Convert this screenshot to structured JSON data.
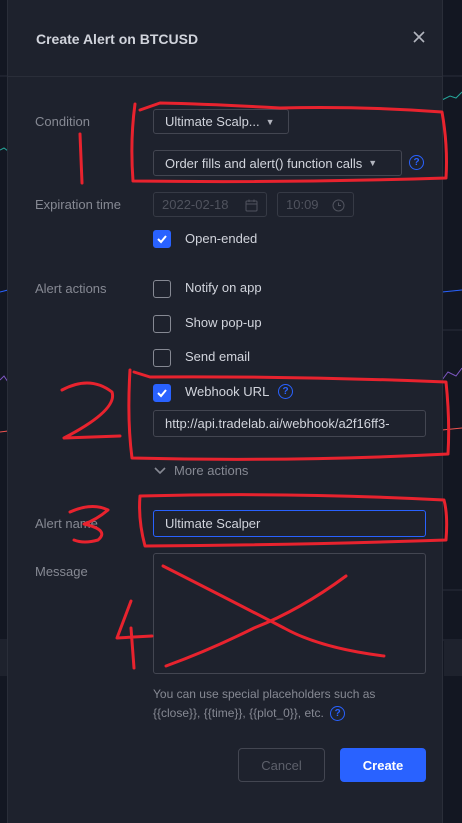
{
  "colors": {
    "accent": "#2962ff",
    "annotation": "#e8232e",
    "dialog_bg": "#1e222d",
    "page_bg": "#131722"
  },
  "dialog": {
    "title": "Create Alert on BTCUSD",
    "close_icon": "close-icon"
  },
  "condition": {
    "label": "Condition",
    "indicator_value": "Ultimate Scalp...",
    "trigger_value": "Order fills and alert() function calls"
  },
  "expiration": {
    "label": "Expiration time",
    "date_value": "2022-02-18",
    "time_value": "10:09",
    "open_ended_label": "Open-ended",
    "open_ended_checked": true
  },
  "alert_actions": {
    "label": "Alert actions",
    "items": [
      {
        "label": "Notify on app",
        "checked": false
      },
      {
        "label": "Show pop-up",
        "checked": false
      },
      {
        "label": "Send email",
        "checked": false
      },
      {
        "label": "Webhook URL",
        "checked": true
      }
    ],
    "webhook_url": "http://api.tradelab.ai/webhook/a2f16ff3-",
    "more_actions_label": "More actions"
  },
  "alert_name": {
    "label": "Alert name",
    "value": "Ultimate Scalper"
  },
  "message": {
    "label": "Message",
    "value": "",
    "hint": "You can use special placeholders such as {{close}}, {{time}}, {{plot_0}}, etc."
  },
  "buttons": {
    "cancel_label": "Cancel",
    "create_label": "Create"
  },
  "annotations": {
    "numbers": [
      "1",
      "2",
      "3",
      "4"
    ]
  }
}
